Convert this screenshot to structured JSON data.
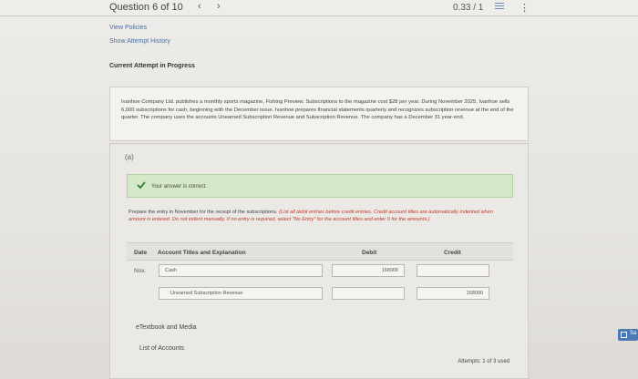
{
  "header": {
    "question_label": "Question 6 of 10",
    "prev_icon": "chevron-left-icon",
    "next_icon": "chevron-right-icon",
    "score": "0.33 / 1",
    "list_icon": "list-icon",
    "more_icon": "more-vertical-icon"
  },
  "links": {
    "view_policies": "View Policies",
    "show_attempt_history": "Show Attempt History"
  },
  "current_attempt": "Current Attempt in Progress",
  "problem": "Ivanhoe Company Ltd. publishes a monthly sports magazine, Fishing Preview. Subscriptions to the magazine cost $28 per year. During November 2025, Ivanhoe sells 6,000 subscriptions for cash, beginning with the December issue. Ivanhoe prepares financial statements quarterly and recognizes subscription revenue at the end of the quarter. The company uses the accounts Unearned Subscription Revenue and Subscription Revenue. The company has a December 31 year-end.",
  "part": {
    "label": "(a)",
    "feedback": "Your answer is correct.",
    "instructions_main": "Prepare the entry in November for the receipt of the subscriptions. ",
    "instructions_emphasis": "(List all debit entries before credit entries. Credit account titles are automatically indented when amount is entered. Do not indent manually. If no entry is required, select \"No Entry\" for the account titles and enter 0 for the amounts.)"
  },
  "table": {
    "headers": {
      "date": "Date",
      "account": "Account Titles and Explanation",
      "debit": "Debit",
      "credit": "Credit"
    },
    "rows": [
      {
        "date": "Nov.",
        "account": "Cash",
        "debit": "168000",
        "credit": ""
      },
      {
        "date": "",
        "account": "Unearned Subscription Revenue",
        "debit": "",
        "credit": "168000"
      }
    ]
  },
  "resources": {
    "etextbook": "eTextbook and Media",
    "list_of_accounts": "List of Accounts"
  },
  "attempts": "Attempts: 1 of 3 used",
  "side_button_label": "Sa"
}
